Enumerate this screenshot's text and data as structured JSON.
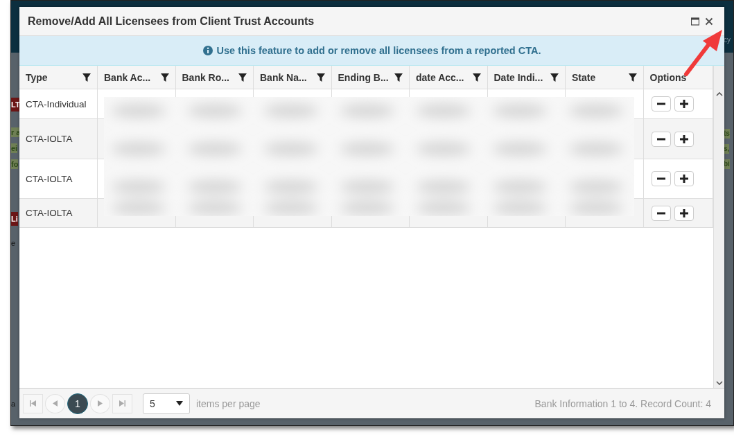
{
  "background": {
    "left_fragments": [
      {
        "text": "LT",
        "kind": "alert"
      },
      {
        "text": "r a",
        "kind": "note"
      },
      {
        "text": "ei",
        "kind": "note"
      },
      {
        "text": "fo",
        "kind": "note"
      },
      {
        "text": "Li",
        "kind": "alert"
      },
      {
        "text": "e",
        "kind": "plain"
      },
      {
        "text": "a",
        "kind": "plain"
      }
    ],
    "right_fragments": [
      {
        "text": "cy",
        "kind": "header"
      },
      {
        "text": "ts",
        "kind": "note"
      },
      {
        "text": "s,",
        "kind": "note"
      },
      {
        "text": "bi",
        "kind": "note"
      }
    ]
  },
  "dialog": {
    "title": "Remove/Add All Licensees from Client Trust Accounts",
    "info": "Use this feature to add or remove all licensees from a reported CTA."
  },
  "table": {
    "columns": [
      {
        "label": "Type",
        "filter": true
      },
      {
        "label": "Bank Ac...",
        "filter": true
      },
      {
        "label": "Bank Ro...",
        "filter": true
      },
      {
        "label": "Bank Na...",
        "filter": true
      },
      {
        "label": "Ending B...",
        "filter": true
      },
      {
        "label": "date Acc...",
        "filter": true
      },
      {
        "label": "Date Indi...",
        "filter": true
      },
      {
        "label": "State",
        "filter": true
      },
      {
        "label": "Options",
        "filter": false
      }
    ],
    "rows": [
      {
        "type": "CTA-Individual"
      },
      {
        "type": "CTA-IOLTA"
      },
      {
        "type": "CTA-IOLTA"
      },
      {
        "type": "CTA-IOLTA"
      }
    ]
  },
  "pager": {
    "pages": [
      {
        "label": "1",
        "selected": true
      }
    ],
    "page_size": "5",
    "page_size_label": "items per page",
    "summary": "Bank Information 1 to 4. Record Count: 4"
  }
}
